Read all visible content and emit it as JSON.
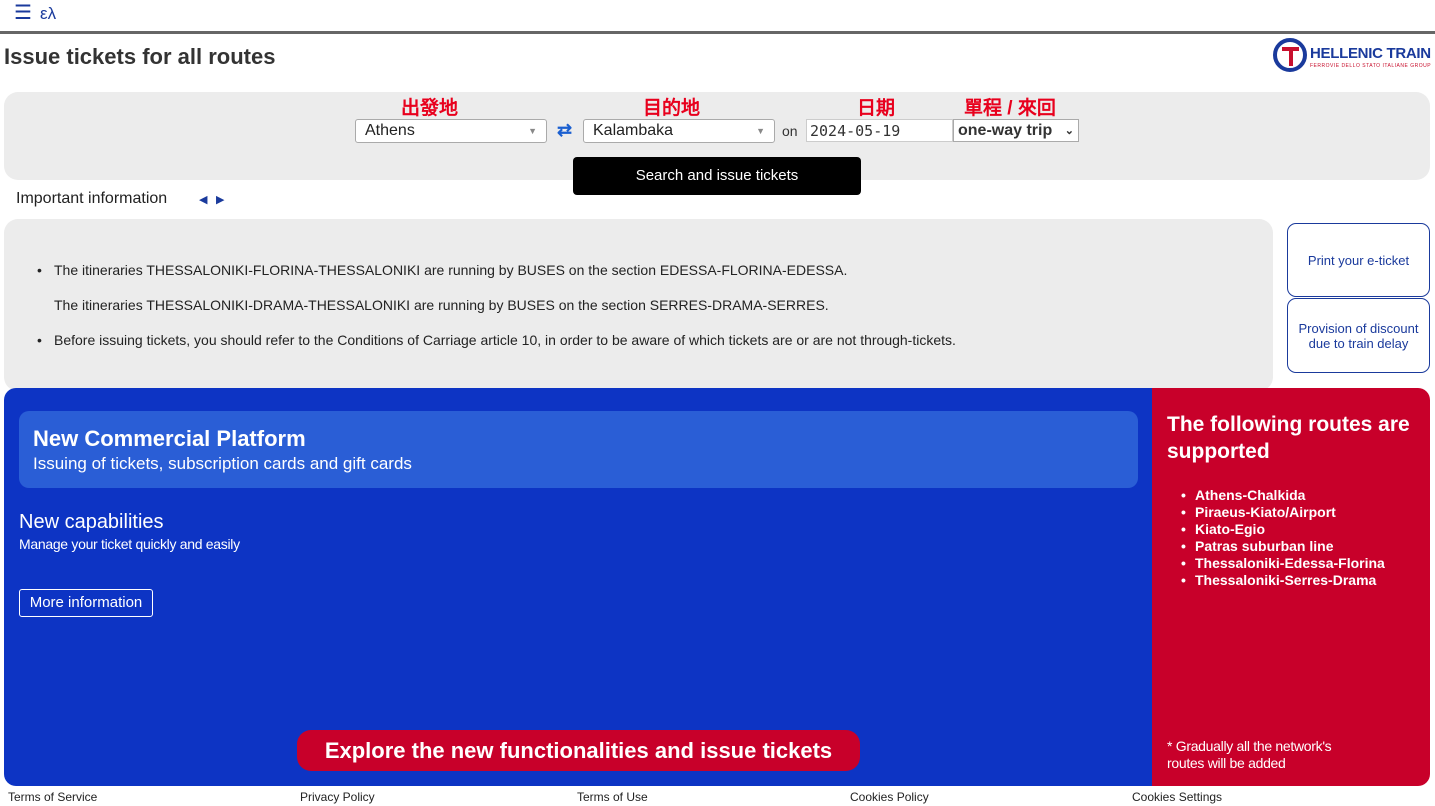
{
  "header": {
    "menu_icon": "hamburger-icon",
    "lang": "ελ"
  },
  "page": {
    "title": "Issue tickets for all routes"
  },
  "logo": {
    "text": "HELLENIC TRAIN",
    "subtext": "FERROVIE DELLO STATO ITALIANE GROUP"
  },
  "search": {
    "labels": {
      "from": "出發地",
      "to": "目的地",
      "date": "日期",
      "trip": "單程 / 來回"
    },
    "from_value": "Athens",
    "to_value": "Kalambaka",
    "on_label": "on",
    "date_value": "2024-05-19",
    "trip_value": "one-way trip",
    "button": "Search and issue tickets"
  },
  "info": {
    "label": "Important information",
    "lines": [
      "The itineraries THESSALONIKI-FLORINA-THESSALONIKI are running by BUSES on the section EDESSA-FLORINA-EDESSA.",
      "The itineraries THESSALONIKI-DRAMA-THESSALONIKI are running by BUSES on the section SERRES-DRAMA-SERRES.",
      "Before issuing tickets, you should refer to the Conditions of Carriage article 10, in order to be aware of which tickets are or are not through-tickets."
    ]
  },
  "side_buttons": {
    "print": "Print your e-ticket",
    "discount": "Provision of discount due to train delay"
  },
  "promo": {
    "platform_title": "New Commercial Platform",
    "platform_sub": "Issuing of tickets, subscription cards and gift cards",
    "cap_title": "New capabilities",
    "cap_sub": "Manage your ticket quickly and easily",
    "more_button": "More information",
    "explore_button": "Explore the new functionalities and issue tickets"
  },
  "routes": {
    "title": "The following routes are supported",
    "items": [
      "Athens-Chalkida",
      "Piraeus-Kiato/Airport",
      "Kiato-Egio",
      "Patras suburban line",
      "Thessaloniki-Edessa-Florina",
      "Thessaloniki-Serres-Drama"
    ],
    "note": "* Gradually all the network's routes will be added"
  },
  "footer": [
    "Terms of Service",
    "Privacy Policy",
    "Terms of Use",
    "Cookies Policy",
    "Cookies Settings"
  ],
  "colors": {
    "brand_blue": "#0d34c4",
    "brand_red": "#c8002a",
    "label_red": "#e8001d"
  }
}
